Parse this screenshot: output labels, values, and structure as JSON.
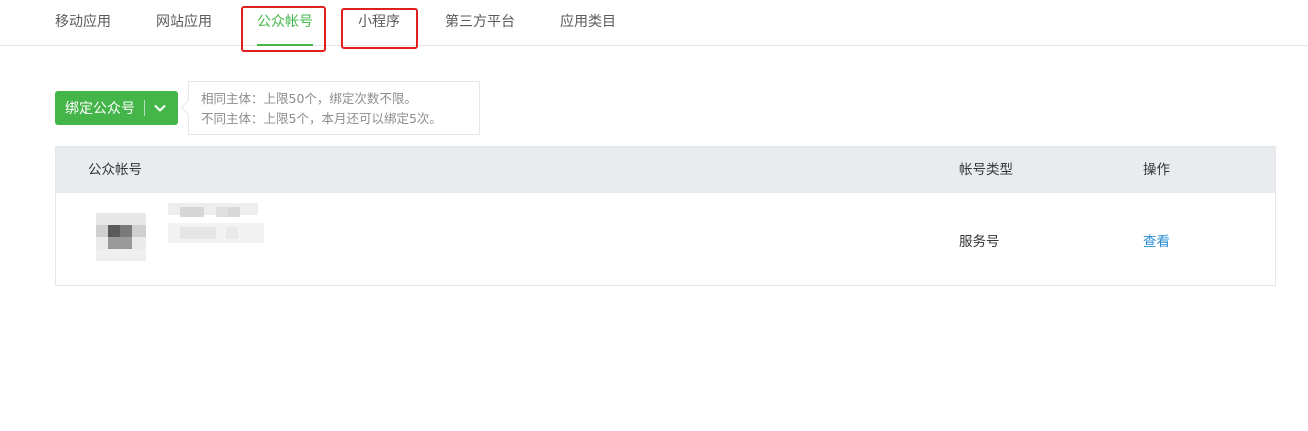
{
  "tabs": [
    {
      "label": "移动应用",
      "active": false
    },
    {
      "label": "网站应用",
      "active": false
    },
    {
      "label": "公众帐号",
      "active": true
    },
    {
      "label": "小程序",
      "active": false
    },
    {
      "label": "第三方平台",
      "active": false
    },
    {
      "label": "应用类目",
      "active": false
    }
  ],
  "bind_button": {
    "label": "绑定公众号",
    "caret_icon": "chevron-down-icon"
  },
  "tip": {
    "line1": "相同主体：上限50个，绑定次数不限。",
    "line2": "不同主体：上限5个，本月还可以绑定5次。"
  },
  "table": {
    "headers": {
      "account": "公众帐号",
      "type": "帐号类型",
      "action": "操作"
    },
    "rows": [
      {
        "type": "服务号",
        "action": "查看"
      }
    ]
  },
  "colors": {
    "accent": "#44b549",
    "highlight": "#e02020",
    "link": "#2b8fd6",
    "header_bg": "#e9ecef"
  }
}
